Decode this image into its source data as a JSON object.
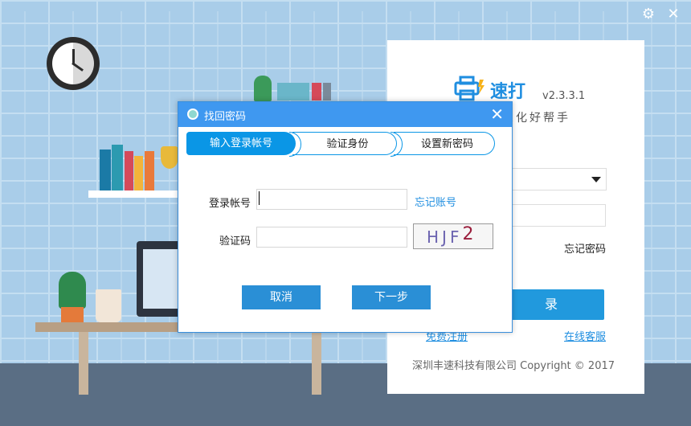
{
  "window_controls": {
    "settings_icon": "gear-icon",
    "close_icon": "close-icon",
    "close_glyph": "✕",
    "settings_glyph": "⚙"
  },
  "login": {
    "brand": "速打",
    "version": "v2.3.3.1",
    "slogan": "信息化好帮手",
    "forgot_password": "忘记密码",
    "login_button": "录",
    "register_link": "免费注册",
    "online_service": "在线客服",
    "copyright": "深圳丰速科技有限公司  Copyright © 2017"
  },
  "dialog": {
    "title": "找回密码",
    "close_glyph": "✕",
    "steps": [
      {
        "label": "输入登录帐号",
        "active": true
      },
      {
        "label": "验证身份",
        "active": false
      },
      {
        "label": "设置新密码",
        "active": false
      }
    ],
    "account_label": "登录帐号",
    "account_value": "",
    "forgot_account": "忘记账号",
    "captcha_label": "验证码",
    "captcha_value": "",
    "captcha_text_main": "HJF",
    "captcha_text_tail": "2",
    "cancel_button": "取消",
    "next_button": "下一步"
  },
  "colors": {
    "accent": "#0a96e6",
    "primary_button": "#2a8fd6",
    "link": "#1f8ee0"
  }
}
